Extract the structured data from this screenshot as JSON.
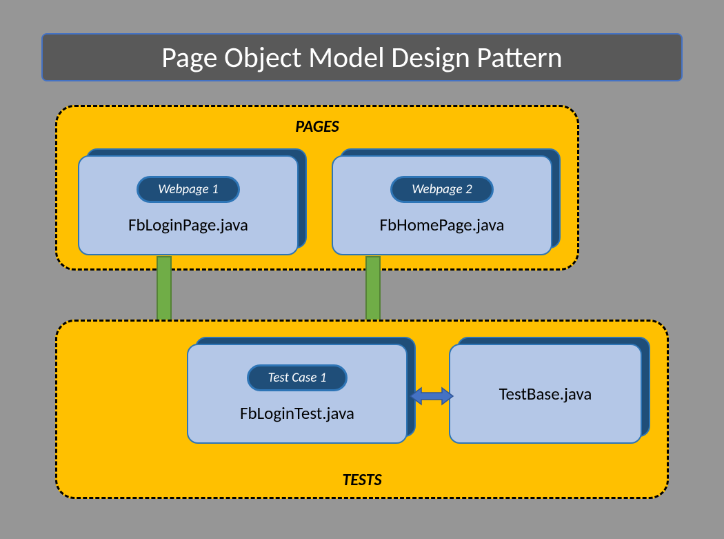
{
  "title": "Page Object Model Design Pattern",
  "pages": {
    "label": "PAGES",
    "cards": [
      {
        "pill": "Webpage 1",
        "file": "FbLoginPage.java"
      },
      {
        "pill": "Webpage 2",
        "file": "FbHomePage.java"
      }
    ]
  },
  "tests": {
    "label": "TESTS",
    "cards": [
      {
        "pill": "Test Case 1",
        "file": "FbLoginTest.java"
      },
      {
        "file": "TestBase.java"
      }
    ]
  }
}
